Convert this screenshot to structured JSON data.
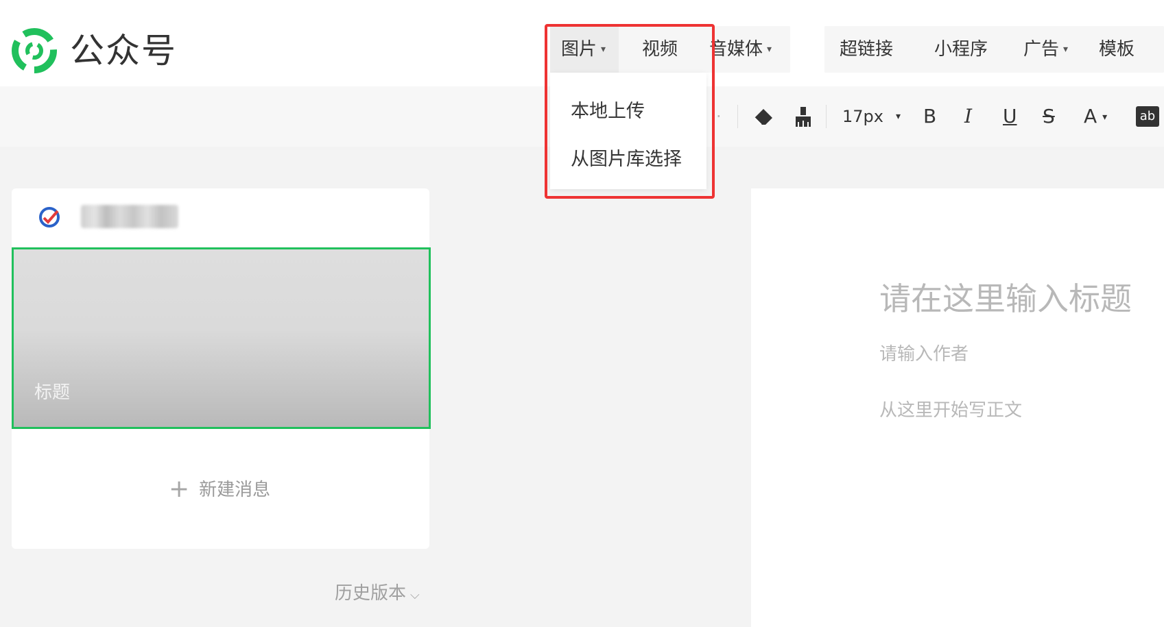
{
  "brand": {
    "name": "公众号",
    "accent": "#20c05c"
  },
  "menu": {
    "image": "图片",
    "video": "视频",
    "audio": "音媒体",
    "link": "超链接",
    "miniprogram": "小程序",
    "ad": "广告",
    "template": "模板",
    "dropdown_marker": "▾"
  },
  "dropdown": {
    "items": [
      "本地上传",
      "从图片库选择"
    ]
  },
  "toolbar": {
    "font_size": "17px",
    "bold": "B",
    "italic": "I",
    "underline": "U",
    "strike": "S",
    "font_color": "A",
    "ab": "ab",
    "trailing_mark": "·"
  },
  "article": {
    "cover_title": "标题",
    "new_message": "新建消息",
    "plus": "+",
    "history": "历史版本",
    "chevron": "⌵"
  },
  "editor": {
    "title_placeholder": "请在这里输入标题",
    "author_placeholder": "请输入作者",
    "body_placeholder": "从这里开始写正文"
  },
  "icons": {
    "logo": "wechat-official-account-logo",
    "avatar": "account-avatar",
    "eraser": "eraser-icon",
    "brush": "format-brush-icon"
  },
  "colors": {
    "highlight": "#ee3333",
    "cover_border": "#20c05c"
  }
}
